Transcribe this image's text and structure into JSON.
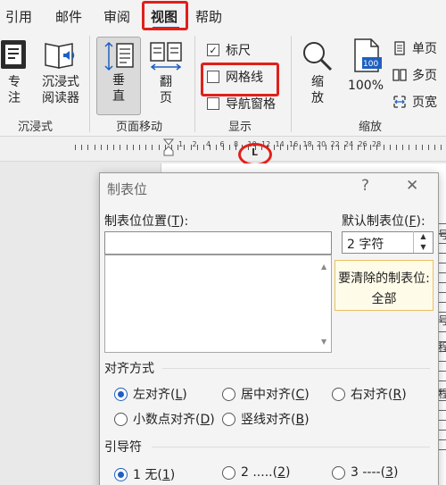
{
  "tabs": [
    {
      "label": "引用"
    },
    {
      "label": "邮件"
    },
    {
      "label": "审阅"
    },
    {
      "label": "视图",
      "active": true
    },
    {
      "label": "帮助"
    }
  ],
  "ribbon": {
    "focus_mode": {
      "line1": "专",
      "line2": "注"
    },
    "immersive_reader": {
      "line1": "沉浸式",
      "line2": "阅读器"
    },
    "group_immersive": "沉浸式",
    "vertical": {
      "line1": "垂",
      "line2": "直"
    },
    "page_flip": {
      "line1": "翻",
      "line2": "页"
    },
    "group_page_move": "页面移动",
    "ruler": {
      "label": "标尺",
      "checked": true
    },
    "gridlines": {
      "label": "网格线",
      "checked": false
    },
    "nav_pane": {
      "label": "导航窗格",
      "checked": false
    },
    "group_show": "显示",
    "zoom": {
      "line1": "缩",
      "line2": "放"
    },
    "zoom100": {
      "label": "100%",
      "badge": "100"
    },
    "single_page": "单页",
    "multi_page": "多页",
    "page_width": "页宽",
    "group_zoom": "缩放"
  },
  "ruler_strip": {
    "numbers": [
      "1",
      "2",
      "4",
      "6",
      "8",
      "10",
      "12",
      "14",
      "16",
      "18",
      "20",
      "22",
      "24",
      "26",
      "28"
    ],
    "tab_marker": "L"
  },
  "dialog": {
    "title": "制表位",
    "help": "?",
    "close": "✕",
    "tab_position_label": "制表位位置(",
    "tab_position_key": "T",
    "tab_position_suffix": "):",
    "tab_position_value": "",
    "default_tab_label": "默认制表位(",
    "default_tab_key": "F",
    "default_tab_suffix": "):",
    "default_tab_value": "2 字符",
    "clear_label": "要清除的制表位:",
    "clear_value": "全部",
    "alignment_label": "对齐方式",
    "alignment": [
      {
        "text": "左对齐(",
        "key": "L",
        "suffix": ")",
        "selected": true
      },
      {
        "text": "居中对齐(",
        "key": "C",
        "suffix": ")",
        "selected": false
      },
      {
        "text": "右对齐(",
        "key": "R",
        "suffix": ")",
        "selected": false
      },
      {
        "text": "小数点对齐(",
        "key": "D",
        "suffix": ")",
        "selected": false
      },
      {
        "text": "竖线对齐(",
        "key": "B",
        "suffix": ")",
        "selected": false
      }
    ],
    "leader_label": "引导符",
    "leader": [
      {
        "text": "1 无(",
        "key": "1",
        "suffix": ")",
        "selected": true
      },
      {
        "text": "2 .....(",
        "key": "2",
        "suffix": ")",
        "selected": false
      },
      {
        "text": "3 ----(",
        "key": "3",
        "suffix": ")",
        "selected": false
      }
    ]
  },
  "doc_edge_chars": [
    "号",
    "号",
    "程",
    "程"
  ],
  "colors": {
    "accent": "#1f5fbf",
    "highlight_red": "#e0201a",
    "clear_box_border": "#e8c060"
  }
}
